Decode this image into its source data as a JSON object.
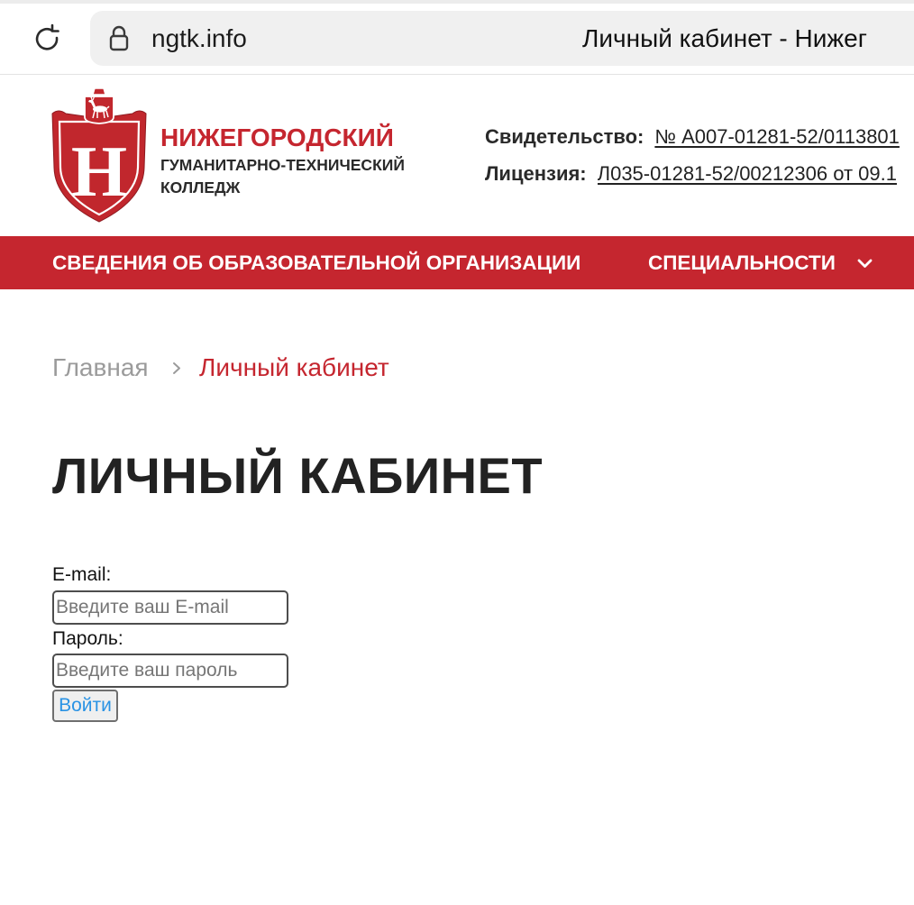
{
  "browser": {
    "url": "ngtk.info",
    "tab_title": "Личный кабинет - Нижег",
    "reload_icon": "reload-icon",
    "lock_icon": "lock-icon"
  },
  "header": {
    "logo": {
      "letter": "Н",
      "emblem_icon": "deer-emblem-icon"
    },
    "college_name": [
      "НИЖЕГОРОДСКИЙ",
      "ГУМАНИТАРНО-ТЕХНИЧЕСКИЙ",
      "КОЛЛЕДЖ"
    ],
    "documents": [
      {
        "label": "Свидетельство:",
        "link": "№ А007-01281-52/0113801"
      },
      {
        "label": "Лицензия:",
        "link": "Л035-01281-52/00212306 от 09.1"
      }
    ]
  },
  "nav": {
    "items": [
      {
        "label": "СВЕДЕНИЯ ОБ ОБРАЗОВАТЕЛЬНОЙ ОРГАНИЗАЦИИ"
      },
      {
        "label": "СПЕЦИАЛЬНОСТИ",
        "icon": "chevron-down-icon"
      }
    ]
  },
  "breadcrumb": {
    "items": [
      {
        "label": "Главная"
      },
      {
        "label": "Личный кабинет"
      }
    ],
    "separator_icon": "chevron-right-icon"
  },
  "main": {
    "title": "ЛИЧНЫЙ КАБИНЕТ"
  },
  "login_form": {
    "email": {
      "label": "E-mail:",
      "value": "",
      "placeholder": "Введите ваш E-mail"
    },
    "password": {
      "label": "Пароль:",
      "value": "",
      "placeholder": "Введите ваш пароль"
    },
    "submit_label": "Войти"
  },
  "colors": {
    "brand_red": "#c5262f",
    "breadcrumb_inactive": "#9b9b9b",
    "button_text": "#2a93e4"
  }
}
